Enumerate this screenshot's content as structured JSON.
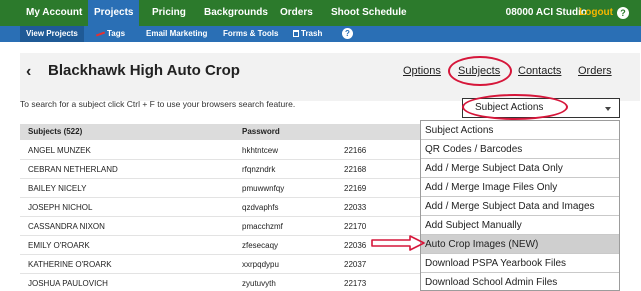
{
  "topnav": {
    "items": [
      "My Account",
      "Projects",
      "Pricing",
      "Backgrounds",
      "Orders",
      "Shoot Schedule"
    ],
    "active_index": 1,
    "studio": "08000 ACI Studio",
    "logout": "Logout",
    "help": "?"
  },
  "subnav": {
    "items": [
      "View Projects",
      "Tags",
      "Email Marketing",
      "Forms & Tools",
      "Trash"
    ],
    "active_index": 0,
    "help": "?"
  },
  "header": {
    "back_icon": "chevron-left-icon",
    "back": "‹",
    "title": "Blackhawk High Auto Crop",
    "tabs": [
      "Options",
      "Subjects",
      "Contacts",
      "Orders"
    ],
    "annotation_color": "#d6163a"
  },
  "hint": "To search for a subject click Ctrl + F to use your browsers search feature.",
  "subject_actions": {
    "selected": "Subject Actions",
    "options": [
      "Subject Actions",
      "QR Codes / Barcodes",
      "Add / Merge Subject Data Only",
      "Add / Merge Image Files Only",
      "Add / Merge Subject Data and Images",
      "Add Subject Manually",
      "Auto Crop Images (NEW)",
      "Download PSPA Yearbook Files",
      "Download School Admin Files"
    ],
    "highlighted_index": 6
  },
  "table": {
    "headers": [
      "Subjects (522)",
      "Password",
      ""
    ],
    "rows": [
      [
        "ANGEL MUNZEK",
        "hkhtntcew",
        "22166"
      ],
      [
        "CEBRAN NETHERLAND",
        "rfqnzndrk",
        "22168"
      ],
      [
        "BAILEY NICELY",
        "pmuwwnfqy",
        "22169"
      ],
      [
        "JOSEPH NICHOL",
        "qzdvaphfs",
        "22033"
      ],
      [
        "CASSANDRA NIXON",
        "pmacchzmf",
        "22170"
      ],
      [
        "EMILY O'ROARK",
        "zfesecaqy",
        "22036"
      ],
      [
        "KATHERINE O'ROARK",
        "xxrpqdypu",
        "22037"
      ],
      [
        "JOSHUA PAULOVICH",
        "zyutuvyth",
        "22173"
      ]
    ]
  },
  "colors": {
    "topnav_bg": "#2c7a2c",
    "subnav_bg": "#2a6fb5",
    "logout": "#f6b700",
    "annotation": "#d6163a"
  }
}
